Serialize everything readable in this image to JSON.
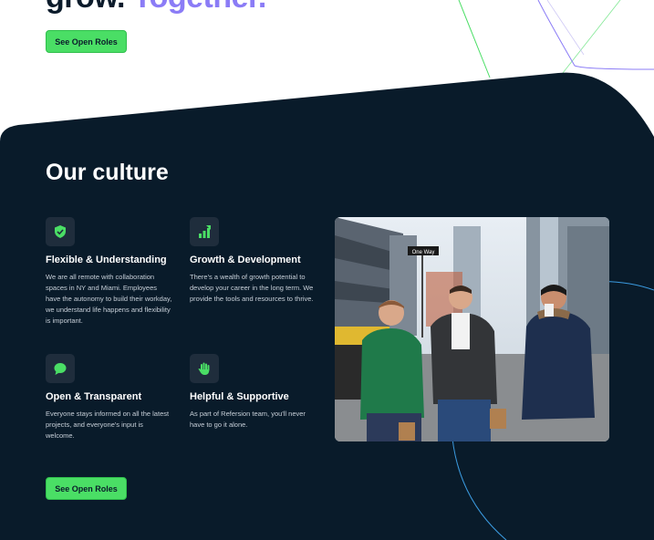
{
  "hero": {
    "title_main": "grow.",
    "title_accent": "Together."
  },
  "buttons": {
    "see_open_roles": "See Open Roles"
  },
  "culture": {
    "title": "Our culture",
    "features": [
      {
        "icon": "shield-check-icon",
        "title": "Flexible & Understanding",
        "desc": "We are all remote with collaboration spaces in NY and Miami. Employees have the autonomy to build their workday, we understand life happens and flexibility is important."
      },
      {
        "icon": "growth-chart-icon",
        "title": "Growth & Development",
        "desc": "There's a wealth of growth potential to develop your career in the long term. We provide the tools and resources to thrive."
      },
      {
        "icon": "chat-bubble-icon",
        "title": "Open & Transparent",
        "desc": "Everyone stays informed on all the latest projects, and everyone's input is welcome."
      },
      {
        "icon": "hand-icon",
        "title": "Helpful & Supportive",
        "desc": "As part of Refersion team, you'll never have to go it alone."
      }
    ],
    "photo": {
      "street_sign": "One Way"
    }
  },
  "colors": {
    "dark_bg": "#091b2a",
    "accent_purple": "#8b7cf6",
    "accent_green": "#4ade65",
    "icon_green": "#4ade65",
    "line_blue": "#3b9be0"
  }
}
